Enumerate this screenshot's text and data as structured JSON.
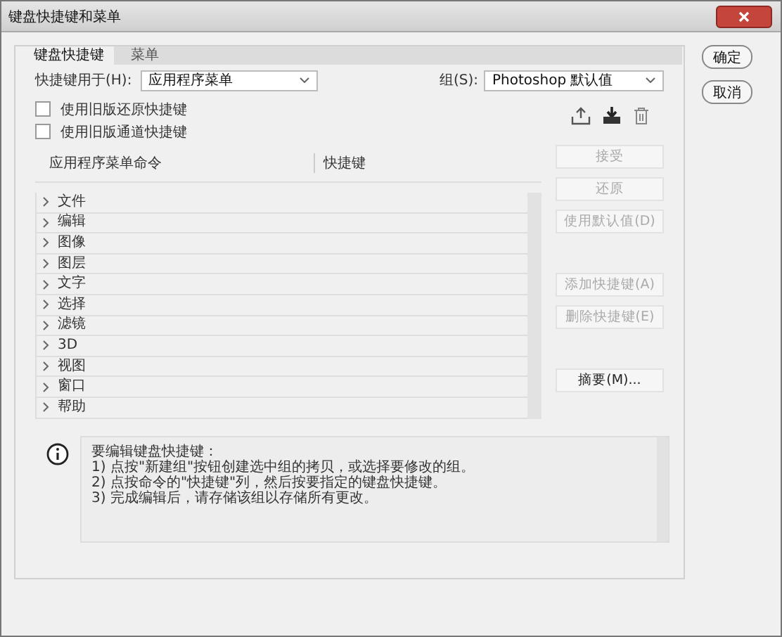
{
  "window": {
    "title": "键盘快捷键和菜单"
  },
  "tabs": [
    {
      "label": "键盘快捷键",
      "selected": true
    },
    {
      "label": "菜单",
      "selected": false
    }
  ],
  "shortcuts_for": {
    "label": "快捷键用于(H):",
    "value": "应用程序菜单"
  },
  "set": {
    "label": "组(S):",
    "value": "Photoshop 默认值"
  },
  "checkboxes": [
    {
      "label": "使用旧版还原快捷键",
      "checked": false
    },
    {
      "label": "使用旧版通道快捷键",
      "checked": false
    }
  ],
  "table": {
    "columns": [
      "应用程序菜单命令",
      "快捷键"
    ],
    "rows": [
      {
        "label": "文件",
        "expanded": false
      },
      {
        "label": "编辑",
        "expanded": false
      },
      {
        "label": "图像",
        "expanded": false
      },
      {
        "label": "图层",
        "expanded": false
      },
      {
        "label": "文字",
        "expanded": false
      },
      {
        "label": "选择",
        "expanded": false
      },
      {
        "label": "滤镜",
        "expanded": false
      },
      {
        "label": "3D",
        "expanded": false
      },
      {
        "label": "视图",
        "expanded": false
      },
      {
        "label": "窗口",
        "expanded": false
      },
      {
        "label": "帮助",
        "expanded": false
      }
    ]
  },
  "side_button_groups": [
    [
      {
        "label": "接受",
        "disabled": true
      },
      {
        "label": "还原",
        "disabled": true
      },
      {
        "label": "使用默认值(D)",
        "disabled": true
      }
    ],
    [
      {
        "label": "添加快捷键(A)",
        "disabled": true
      },
      {
        "label": "删除快捷键(E)",
        "disabled": true
      }
    ],
    [
      {
        "label": "摘要(M)...",
        "disabled": false
      }
    ]
  ],
  "info": [
    "要编辑键盘快捷键：",
    "1) 点按\"新建组\"按钮创建选中组的拷贝，或选择要修改的组。",
    "2) 点按命令的\"快捷键\"列，然后按要指定的键盘快捷键。",
    "3) 完成编辑后，请存储该组以存储所有更改。"
  ],
  "dialog_buttons": [
    "确定",
    "取消"
  ]
}
